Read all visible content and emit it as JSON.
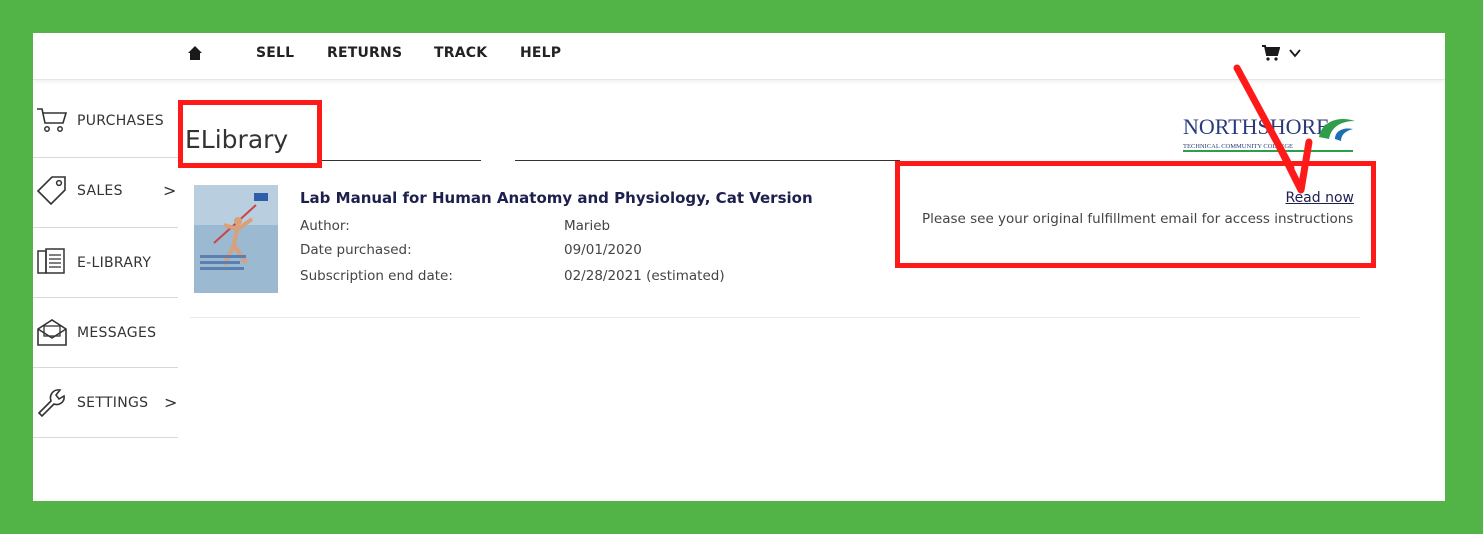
{
  "nav": {
    "links": [
      "SELL",
      "RETURNS",
      "TRACK",
      "HELP"
    ],
    "home_icon": "home-icon",
    "cart_icon": "cart-icon"
  },
  "sidebar": {
    "items": [
      {
        "label": "PURCHASES",
        "icon": "cart-outline-icon"
      },
      {
        "label": "SALES",
        "icon": "tag-icon",
        "arrow": ">"
      },
      {
        "label": "E-LIBRARY",
        "icon": "book-list-icon"
      },
      {
        "label": "MESSAGES",
        "icon": "envelope-icon"
      },
      {
        "label": "SETTINGS",
        "icon": "wrench-icon",
        "arrow": ">"
      }
    ]
  },
  "page": {
    "title": "ELibrary",
    "logo": {
      "name": "NORTHSHORE",
      "subtitle": "TECHNICAL COMMUNITY COLLEGE"
    }
  },
  "book": {
    "title": "Lab Manual for Human Anatomy and Physiology, Cat Version",
    "author_label": "Author:",
    "author": "Marieb",
    "date_label": "Date purchased:",
    "date": "09/01/2020",
    "sub_label": "Subscription end date:",
    "sub_end": "02/28/2021 (estimated)",
    "read_now": "Read now",
    "instructions": "Please see your original fulfillment email for access instructions"
  },
  "colors": {
    "background": "#52b447",
    "annotation": "#ff1a1a",
    "title_text": "#1d1f4d"
  }
}
